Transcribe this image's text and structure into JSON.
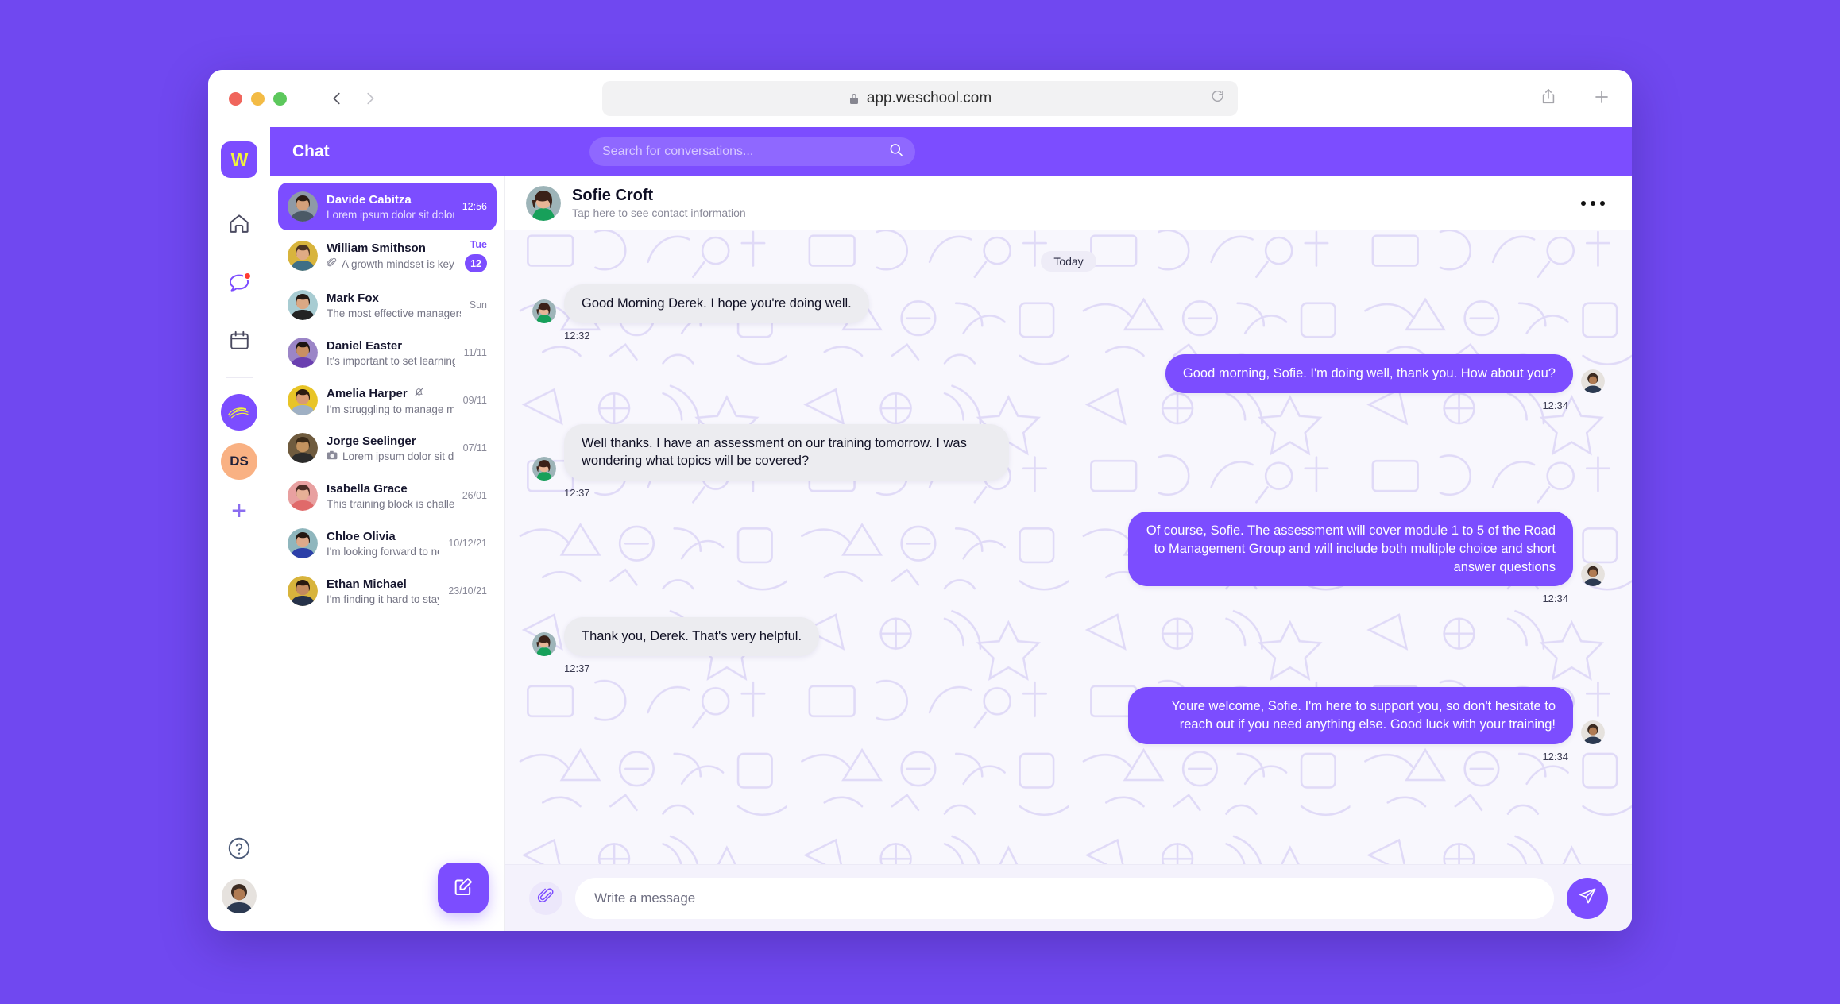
{
  "browser": {
    "url": "app.weschool.com",
    "icons": [
      "lock-icon",
      "reload-icon",
      "share-icon",
      "new-tab-icon",
      "back-icon",
      "forward-icon"
    ]
  },
  "rail": {
    "logo_text": "W",
    "items": [
      {
        "name": "home-icon",
        "label": "Home"
      },
      {
        "name": "chat-icon",
        "label": "Chat",
        "badge": true
      },
      {
        "name": "calendar-icon",
        "label": "Calendar"
      }
    ],
    "groups": [
      {
        "name": "group-avatar-scribble",
        "label": ""
      },
      {
        "name": "group-avatar-ds",
        "label": "DS"
      }
    ],
    "add_label": "+",
    "help_label": "?"
  },
  "topbar": {
    "title": "Chat",
    "search_placeholder": "Search for conversations...",
    "search_value": ""
  },
  "conversations": [
    {
      "name": "Davide Cabitza",
      "preview": "Lorem ipsum dolor sit dolor sit lore...",
      "time": "12:56",
      "active": true,
      "unread": "",
      "attachment": "",
      "muted": false,
      "av": "#8e9aa6"
    },
    {
      "name": "William Smithson",
      "preview": "A growth mindset is key to...",
      "time": "Tue",
      "active": false,
      "unread": "12",
      "attachment": "paperclip-icon",
      "muted": false,
      "av": "#d8b43c"
    },
    {
      "name": "Mark Fox",
      "preview": "The most effective managers are...",
      "time": "Sun",
      "active": false,
      "unread": "",
      "attachment": "",
      "muted": false,
      "av": "#a8ccd2"
    },
    {
      "name": "Daniel Easter",
      "preview": "It's important to set learning goals...",
      "time": "11/11",
      "active": false,
      "unread": "",
      "attachment": "",
      "muted": false,
      "av": "#9b85c7"
    },
    {
      "name": "Amelia Harper",
      "preview": "I'm struggling to manage my time,...",
      "time": "09/11",
      "active": false,
      "unread": "",
      "attachment": "",
      "muted": true,
      "av": "#e8c427"
    },
    {
      "name": "Jorge Seelinger",
      "preview": "Lorem ipsum dolor sit dolor sit lore...",
      "time": "07/11",
      "active": false,
      "unread": "",
      "attachment": "camera-icon",
      "muted": false,
      "av": "#6f5b3e"
    },
    {
      "name": "Isabella Grace",
      "preview": "This training block is challenging,...",
      "time": "26/01",
      "active": false,
      "unread": "",
      "attachment": "",
      "muted": false,
      "av": "#e8a0a0"
    },
    {
      "name": "Chloe Olivia",
      "preview": "I'm looking forward to next...",
      "time": "10/12/21",
      "active": false,
      "unread": "",
      "attachment": "",
      "muted": false,
      "av": "#8fb6bd"
    },
    {
      "name": "Ethan Michael",
      "preview": "I'm finding it hard to stay motivate...",
      "time": "23/10/21",
      "active": false,
      "unread": "",
      "attachment": "",
      "muted": false,
      "av": "#d8b43c"
    }
  ],
  "chat_header": {
    "name": "Sofie Croft",
    "subtitle": "Tap here to see contact information",
    "menu_icon": "more-options-icon"
  },
  "thread": {
    "day_separator": "Today",
    "messages": [
      {
        "dir": "in",
        "text": "Good Morning Derek. I hope you're doing well.",
        "time": "12:32"
      },
      {
        "dir": "out",
        "text": "Good morning, Sofie. I'm doing well, thank you. How about you?",
        "time": "12:34"
      },
      {
        "dir": "in",
        "text": "Well thanks. I have an assessment on our training tomorrow. I was wondering what topics will be covered?",
        "time": "12:37"
      },
      {
        "dir": "out",
        "text": "Of course, Sofie. The assessment will cover module 1 to 5 of the Road to Management Group and will include both multiple choice and short answer questions",
        "time": "12:34"
      },
      {
        "dir": "in",
        "text": "Thank you, Derek. That's very helpful.",
        "time": "12:37"
      },
      {
        "dir": "out",
        "text": "Youre welcome, Sofie. I'm here to support you, so don't hesitate to reach out if you need anything else. Good luck with your training!",
        "time": "12:34"
      }
    ]
  },
  "composer": {
    "placeholder": "Write a message",
    "value": "",
    "attach_icon": "paperclip-icon",
    "send_icon": "send-icon"
  },
  "colors": {
    "brand_purple": "#7c4dff",
    "page_purple": "#7048f0",
    "logo_yellow": "#f2f53a",
    "badge_red": "#ff3b30",
    "chat_bg": "#f8f7fd",
    "incoming_bubble": "#ececf0"
  }
}
